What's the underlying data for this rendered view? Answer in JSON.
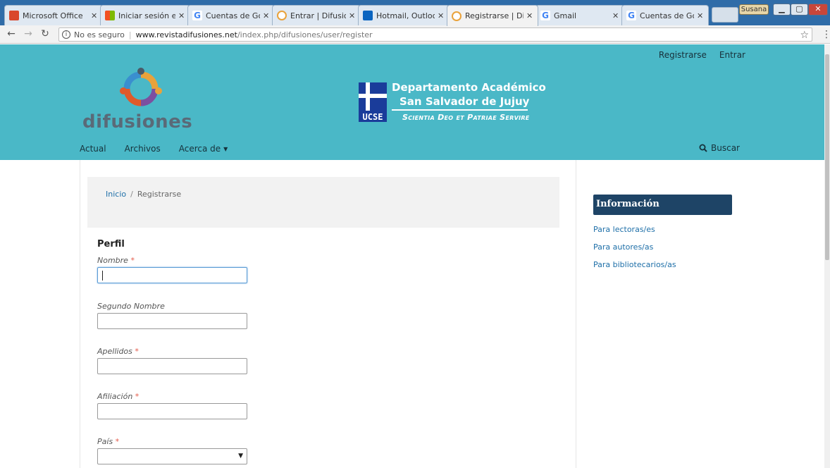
{
  "browser": {
    "tabs": [
      {
        "label": "Microsoft Office",
        "active": false
      },
      {
        "label": "Iniciar sesión en",
        "active": false
      },
      {
        "label": "Cuentas de Goo",
        "active": false
      },
      {
        "label": "Entrar | Difusion",
        "active": false
      },
      {
        "label": "Hotmail, Outlook",
        "active": false
      },
      {
        "label": "Registrarse | Dif",
        "active": true
      },
      {
        "label": "Gmail",
        "active": false
      },
      {
        "label": "Cuentas de Goo",
        "active": false
      }
    ],
    "user_badge": "Susana",
    "security_label": "No es seguro",
    "url_host": "www.revistadifusiones.net",
    "url_path": "/index.php/difusiones/user/register"
  },
  "header": {
    "user_nav": {
      "register": "Registrarse",
      "login": "Entrar"
    },
    "logo_text": "difusiones",
    "dept": {
      "line1": "Departamento Académico",
      "line2": "San Salvador de Jujuy",
      "motto": "Scientia Deo et Patriae Servire",
      "shield_text": "UCSE"
    },
    "nav": {
      "current": "Actual",
      "archives": "Archivos",
      "about": "Acerca de"
    },
    "search_label": "Buscar"
  },
  "breadcrumb": {
    "home": "Inicio",
    "separator": "/",
    "current": "Registrarse"
  },
  "form": {
    "section_title": "Perfil",
    "required_mark": "*",
    "fields": {
      "nombre": "Nombre",
      "segundo_nombre": "Segundo Nombre",
      "apellidos": "Apellidos",
      "afiliacion": "Afiliación",
      "pais": "País"
    }
  },
  "sidebar": {
    "title": "Información",
    "links": [
      "Para lectoras/es",
      "Para autores/as",
      "Para bibliotecarios/as"
    ]
  },
  "colors": {
    "header_bg": "#4ab8c7",
    "sidebar_title_bg": "#1e4466",
    "link": "#1e6fa8",
    "required": "#e45a4a"
  }
}
